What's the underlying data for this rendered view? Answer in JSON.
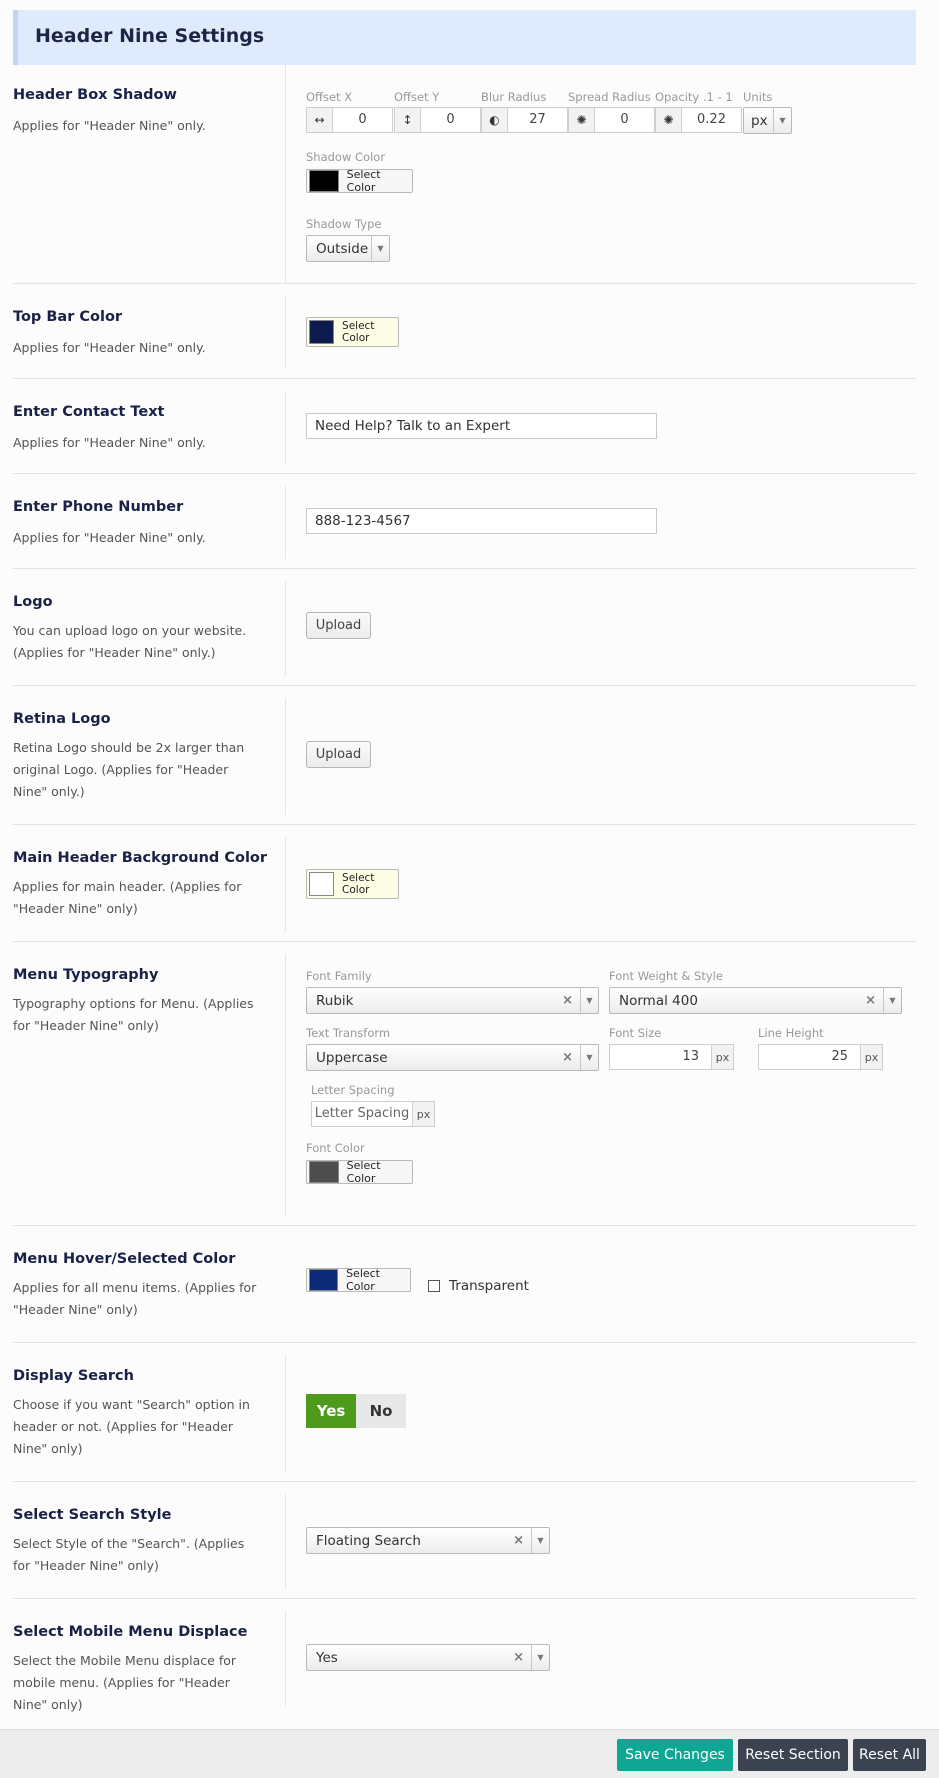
{
  "section": {
    "title": "Header Nine Settings"
  },
  "box_shadow": {
    "title": "Header Box Shadow",
    "desc": "Applies for \"Header Nine\" only.",
    "offset_x": {
      "label": "Offset X",
      "value": "0"
    },
    "offset_y": {
      "label": "Offset Y",
      "value": "0"
    },
    "blur": {
      "label": "Blur Radius",
      "value": "27"
    },
    "spread": {
      "label": "Spread Radius",
      "value": "0"
    },
    "opacity": {
      "label": "Opacity .1 - 1",
      "value": "0.22"
    },
    "units": {
      "label": "Units",
      "value": "px"
    },
    "shadow_color": {
      "label": "Shadow Color",
      "button": "Select Color",
      "swatch": "#000000"
    },
    "shadow_type": {
      "label": "Shadow Type",
      "value": "Outside"
    }
  },
  "top_bar_color": {
    "title": "Top Bar Color",
    "desc": "Applies for \"Header Nine\" only.",
    "button": "Select Color",
    "swatch": "#0c1b4d"
  },
  "contact_text": {
    "title": "Enter Contact Text",
    "desc": "Applies for \"Header Nine\" only.",
    "value": "Need Help? Talk to an Expert"
  },
  "phone": {
    "title": "Enter Phone Number",
    "desc": "Applies for \"Header Nine\" only.",
    "value": "888-123-4567"
  },
  "logo": {
    "title": "Logo",
    "desc": "You can upload logo on your website. (Applies for \"Header Nine\" only.)",
    "button": "Upload"
  },
  "retina_logo": {
    "title": "Retina Logo",
    "desc": "Retina Logo should be 2x larger than original Logo. (Applies for \"Header Nine\" only.)",
    "button": "Upload"
  },
  "main_bg": {
    "title": "Main Header Background Color",
    "desc": "Applies for main header. (Applies for \"Header Nine\" only)",
    "button": "Select Color",
    "swatch": "#ffffff"
  },
  "menu_typo": {
    "title": "Menu Typography",
    "desc": "Typography options for Menu. (Applies for \"Header Nine\" only)",
    "font_family": {
      "label": "Font Family",
      "value": "Rubik"
    },
    "font_weight": {
      "label": "Font Weight & Style",
      "value": "Normal 400"
    },
    "text_transform": {
      "label": "Text Transform",
      "value": "Uppercase"
    },
    "font_size": {
      "label": "Font Size",
      "value": "13",
      "unit": "px"
    },
    "line_height": {
      "label": "Line Height",
      "value": "25",
      "unit": "px"
    },
    "letter_spacing": {
      "label": "Letter Spacing",
      "placeholder": "Letter Spacing",
      "unit": "px"
    },
    "font_color": {
      "label": "Font Color",
      "button": "Select Color",
      "swatch": "#4d4d4d"
    }
  },
  "hover_color": {
    "title": "Menu Hover/Selected Color",
    "desc": "Applies for all menu items. (Applies for \"Header Nine\" only)",
    "button": "Select Color",
    "swatch": "#0a2a78",
    "transparent_label": "Transparent"
  },
  "display_search": {
    "title": "Display Search",
    "desc": "Choose if you want \"Search\" option in header or not. (Applies for \"Header Nine\" only)",
    "yes": "Yes",
    "no": "No"
  },
  "search_style": {
    "title": "Select Search Style",
    "desc": "Select Style of the \"Search\". (Applies for \"Header Nine\" only)",
    "value": "Floating Search"
  },
  "mobile_displace": {
    "title": "Select Mobile Menu Displace",
    "desc": "Select the Mobile Menu displace for mobile menu. (Applies for \"Header Nine\" only)",
    "value": "Yes"
  },
  "footer": {
    "save": "Save Changes",
    "reset_section": "Reset Section",
    "reset_all": "Reset All"
  }
}
